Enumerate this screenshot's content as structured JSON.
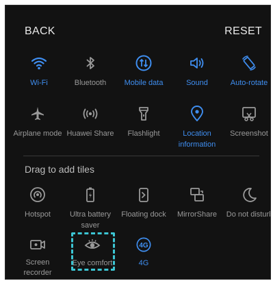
{
  "header": {
    "back_label": "BACK",
    "reset_label": "RESET"
  },
  "colors": {
    "active": "#3f8ef0",
    "inactive": "#9a9a9a",
    "highlight": "#3cc5d3"
  },
  "active_tiles": [
    {
      "label": "Wi-Fi",
      "icon": "wifi-icon",
      "enabled": true
    },
    {
      "label": "Bluetooth",
      "icon": "bluetooth-icon",
      "enabled": false
    },
    {
      "label": "Mobile data",
      "icon": "mobile-data-icon",
      "enabled": true
    },
    {
      "label": "Sound",
      "icon": "sound-icon",
      "enabled": true
    },
    {
      "label": "Auto-rotate",
      "icon": "auto-rotate-icon",
      "enabled": true
    },
    {
      "label": "Airplane mode",
      "icon": "airplane-icon",
      "enabled": false
    },
    {
      "label": "Huawei Share",
      "icon": "huawei-share-icon",
      "enabled": false
    },
    {
      "label": "Flashlight",
      "icon": "flashlight-icon",
      "enabled": false
    },
    {
      "label": "Location information",
      "icon": "location-icon",
      "enabled": true
    },
    {
      "label": "Screenshot",
      "icon": "screenshot-icon",
      "enabled": false
    }
  ],
  "available_section": {
    "title": "Drag to add tiles",
    "tiles": [
      {
        "label": "Hotspot",
        "icon": "hotspot-icon",
        "enabled": false
      },
      {
        "label": "Ultra battery saver",
        "icon": "battery-saver-icon",
        "enabled": false
      },
      {
        "label": "Floating dock",
        "icon": "floating-dock-icon",
        "enabled": false
      },
      {
        "label": "MirrorShare",
        "icon": "mirrorshare-icon",
        "enabled": false
      },
      {
        "label": "Do not disturb",
        "icon": "do-not-disturb-icon",
        "enabled": false
      },
      {
        "label": "Screen recorder",
        "icon": "screen-recorder-icon",
        "enabled": false
      },
      {
        "label": "Eye comfort",
        "icon": "eye-comfort-icon",
        "enabled": false,
        "highlighted": true
      },
      {
        "label": "4G",
        "icon": "4g-icon",
        "enabled": true
      }
    ]
  }
}
